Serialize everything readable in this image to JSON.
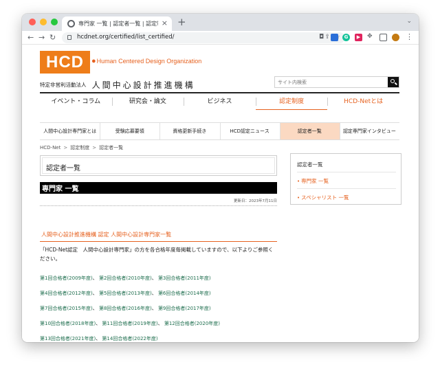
{
  "browser": {
    "tab_title": "専門家 一覧 | 認定者一覧 | 認定制度",
    "tab_close": "×",
    "new_tab": "+",
    "tabs_menu": "⌄",
    "back": "←",
    "forward": "→",
    "reload": "↻",
    "url": "hcdnet.org/certified/list_certified/",
    "extensions": [
      {
        "name": "grammarly-extension",
        "label": "G",
        "color": "#15c39a"
      },
      {
        "name": "red-extension",
        "label": "▶",
        "color": "#e0245e"
      }
    ],
    "menu": "⋮"
  },
  "header": {
    "logo_text": "HCD",
    "logo_subtitle": "Human Centered Design Organization",
    "org_prefix": "特定非営利活動法人",
    "org_name": "人間中心設計推進機構",
    "search_placeholder": "サイト内検索"
  },
  "main_nav": [
    {
      "label": "イベント・コラム"
    },
    {
      "label": "研究会・論文"
    },
    {
      "label": "ビジネス"
    },
    {
      "label": "認定制度"
    },
    {
      "label": "HCD-Netとは"
    }
  ],
  "sub_nav": [
    {
      "label": "人間中心設計専門家とは"
    },
    {
      "label": "受験応募要領"
    },
    {
      "label": "資格更新手続き"
    },
    {
      "label": "HCD認定ニュース"
    },
    {
      "label": "認定者一覧"
    },
    {
      "label": "認定専門家インタビュー"
    }
  ],
  "breadcrumb": {
    "items": [
      "HCD-Net",
      "認定制度",
      "認定者一覧"
    ],
    "separator": ">"
  },
  "content": {
    "page_title": "認定者一覧",
    "section_title": "専門家 一覧",
    "updated": "更新日：2023年7月11日",
    "heading": "人間中心設計推進機構 認定 人間中心設計専門家一覧",
    "intro": "「HCD-Net認定　人間中心設計専門家」の方を各合格年度毎掲載していますので、以下よりご参照ください。",
    "links": [
      "第1回合格者(2009年度)",
      "第2回合格者(2010年度)",
      "第3回合格者(2011年度)",
      "第4回合格者(2012年度)",
      "第5回合格者(2013年度)",
      "第6回合格者(2014年度)",
      "第7回合格者(2015年度)",
      "第8回合格者(2016年度)",
      "第9回合格者(2017年度)",
      "第10回合格者(2018年度)",
      "第11回合格者(2019年度)",
      "第12回合格者(2020年度)",
      "第13回合格者(2021年度)",
      "第14回合格者(2022年度)"
    ],
    "separator": "、"
  },
  "sidebar": {
    "title": "認定者一覧",
    "items": [
      "専門家 一覧",
      "スペシャリスト 一覧"
    ],
    "bullet": "•"
  },
  "colors": {
    "accent": "#e6611f",
    "logo_bg": "#ee7d1a",
    "link": "#1e6e4e",
    "active_subnav": "#fbd9c2"
  }
}
